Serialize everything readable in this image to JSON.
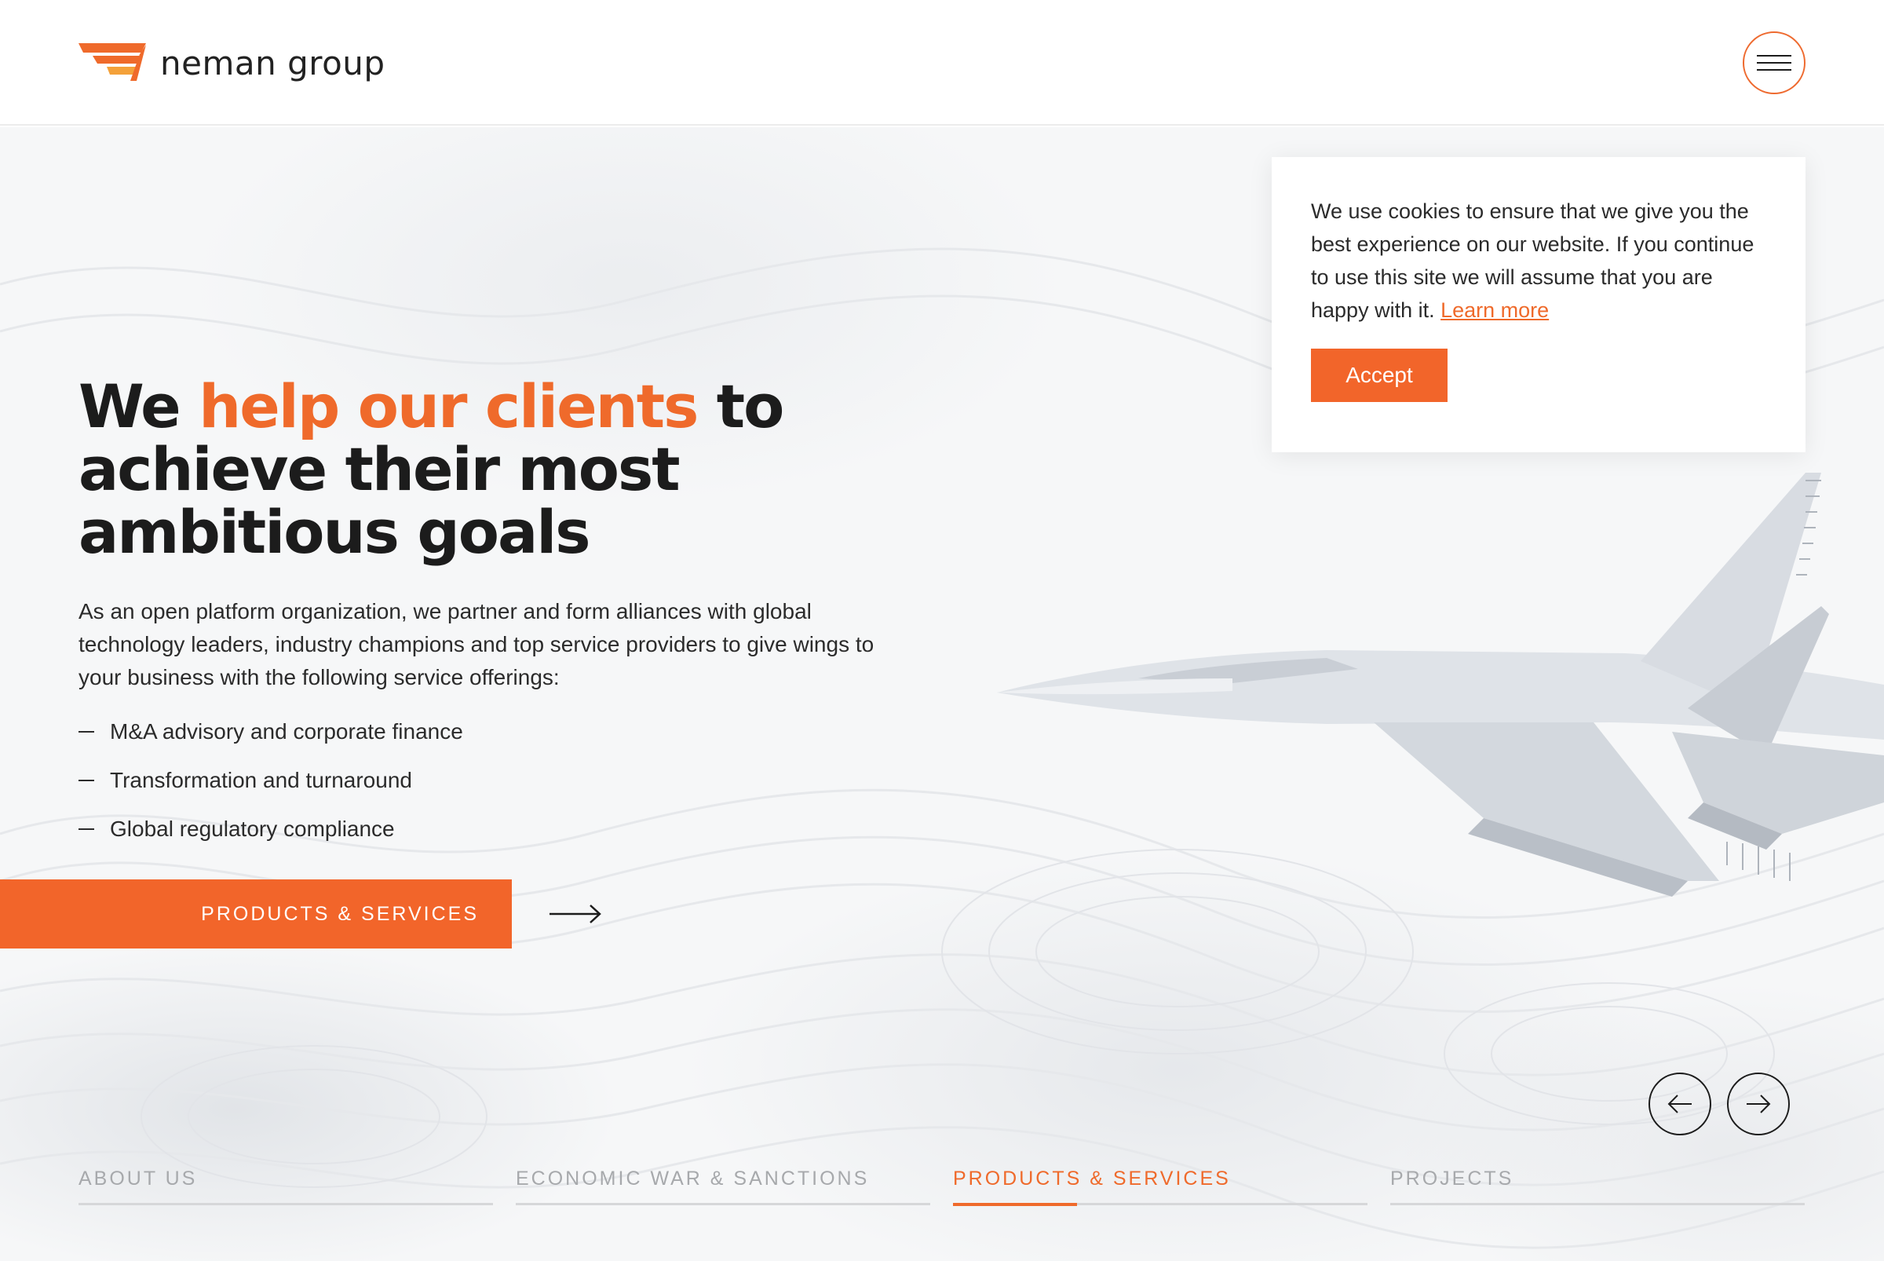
{
  "header": {
    "logo_text": "neman group",
    "menu_icon": "hamburger-menu-icon",
    "accent_color": "#ef6a2b"
  },
  "hero": {
    "headline_part1": "We ",
    "headline_accent": "help our clients",
    "headline_part2": " to achieve their most ambitious goals",
    "intro": "As an open platform organization, we partner and form alliances with global technology leaders, industry champions and top service providers to give wings to your business with the following service offerings:",
    "offerings": [
      "M&A advisory and corporate finance",
      "Transformation and turnaround",
      "Global regulatory compliance"
    ],
    "cta_label": "PRODUCTS & SERVICES",
    "cta_icon": "arrow-right-icon"
  },
  "cookie_banner": {
    "text": "We use cookies to ensure that we give you the best experience on our website. If you continue to use this site we will assume that you are happy with it. ",
    "link_label": "Learn more",
    "accept_label": "Accept"
  },
  "slider": {
    "prev_icon": "arrow-left-icon",
    "next_icon": "arrow-right-icon"
  },
  "tabs": [
    {
      "label": "ABOUT US",
      "active": false
    },
    {
      "label": "ECONOMIC WAR & SANCTIONS",
      "active": false
    },
    {
      "label": "PRODUCTS & SERVICES",
      "active": true,
      "progress": 0.3
    },
    {
      "label": "PROJECTS",
      "active": false
    }
  ]
}
